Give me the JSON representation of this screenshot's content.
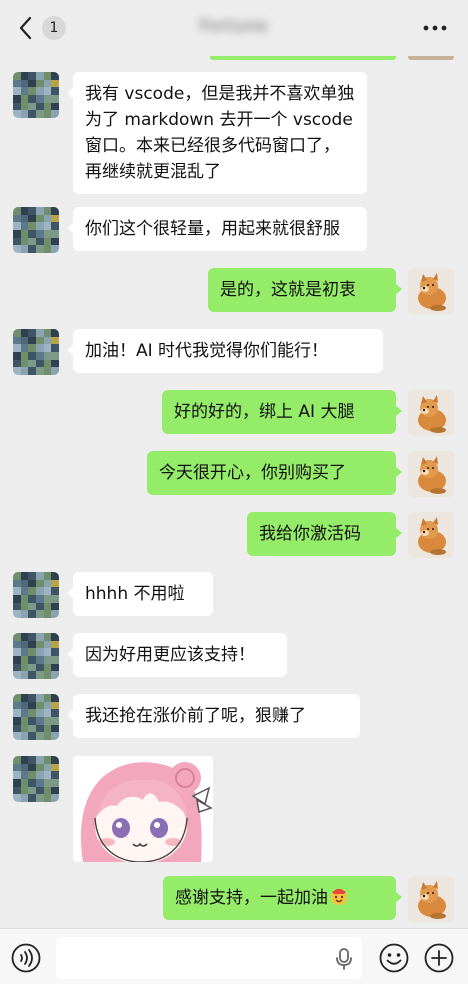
{
  "header": {
    "back_label": "<",
    "unread_count": "1",
    "title": "Fortune",
    "more_label": "···"
  },
  "messages": [
    {
      "side": "in",
      "type": "text",
      "text": "我有 vscode，但是我并不喜欢单独为了 markdown 去开一个 vscode 窗口。本来已经很多代码窗口了，再继续就更混乱了"
    },
    {
      "side": "in",
      "type": "text",
      "text": "你们这个很轻量，用起来就很舒服"
    },
    {
      "side": "out",
      "type": "text",
      "text": "是的，这就是初衷"
    },
    {
      "side": "in",
      "type": "text",
      "text": "加油！AI 时代我觉得你们能行！"
    },
    {
      "side": "out",
      "type": "text",
      "text": "好的好的，绑上 AI 大腿"
    },
    {
      "side": "out",
      "type": "text",
      "text": "今天很开心，你别购买了"
    },
    {
      "side": "out",
      "type": "text",
      "text": "我给你激活码"
    },
    {
      "side": "in",
      "type": "text",
      "text": "hhhh 不用啦"
    },
    {
      "side": "in",
      "type": "text",
      "text": "因为好用更应该支持！"
    },
    {
      "side": "in",
      "type": "text",
      "text": "我还抢在涨价前了呢，狠赚了"
    },
    {
      "side": "in",
      "type": "sticker",
      "sticker": "pink-hair-anime-girl-sticker"
    },
    {
      "side": "out",
      "type": "text",
      "text": "感谢支持，一起加油",
      "emoji": "cheering-face-emoji"
    }
  ],
  "input_bar": {
    "voice_icon": "voice-mode-icon",
    "mic_icon": "microphone-icon",
    "emoji_icon": "emoji-face-icon",
    "plus_icon": "plus-circle-icon",
    "input_value": ""
  },
  "colors": {
    "background": "#ededed",
    "incoming_bubble": "#ffffff",
    "outgoing_bubble": "#95ec69",
    "input_bar": "#f7f7f7"
  }
}
